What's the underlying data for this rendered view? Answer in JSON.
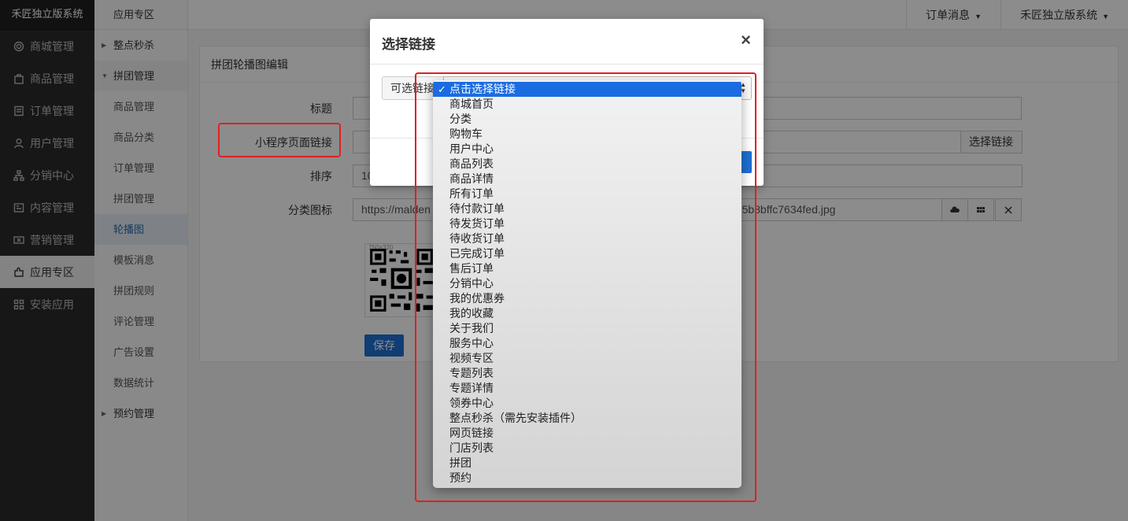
{
  "brand": "禾匠独立版系统",
  "sidebar": {
    "items": [
      {
        "label": "商城管理",
        "icon": "gear-icon"
      },
      {
        "label": "商品管理",
        "icon": "bag-icon"
      },
      {
        "label": "订单管理",
        "icon": "clipboard-icon"
      },
      {
        "label": "用户管理",
        "icon": "user-icon"
      },
      {
        "label": "分销中心",
        "icon": "network-icon"
      },
      {
        "label": "内容管理",
        "icon": "content-icon"
      },
      {
        "label": "营销管理",
        "icon": "ticket-icon"
      },
      {
        "label": "应用专区",
        "icon": "puzzle-icon"
      },
      {
        "label": "安装应用",
        "icon": "grid-icon"
      }
    ]
  },
  "submenu": {
    "head": "应用专区",
    "items": [
      "整点秒杀",
      "拼团管理",
      "商品管理",
      "商品分类",
      "订单管理",
      "拼团管理",
      "轮播图",
      "模板消息",
      "拼团规则",
      "评论管理",
      "广告设置",
      "数据统计",
      "预约管理"
    ]
  },
  "topbar": {
    "orders": "订单消息",
    "system": "禾匠独立版系统"
  },
  "panel": {
    "title": "拼团轮播图编辑",
    "labels": {
      "title": "标题",
      "link": "小程序页面链接",
      "sort": "排序",
      "icon": "分类图标"
    },
    "sort_value": "10",
    "choose_link": "选择链接",
    "icon_url_start": "https://malden",
    "icon_url_end": "d65b8bffc7634fed.jpg",
    "qr_size": "750×320",
    "save": "保存"
  },
  "modal": {
    "title": "选择链接",
    "close": "×",
    "option_label": "可选链接"
  },
  "dropdown": {
    "options": [
      "点击选择链接",
      "商城首页",
      "分类",
      "购物车",
      "用户中心",
      "商品列表",
      "商品详情",
      "所有订单",
      "待付款订单",
      "待发货订单",
      "待收货订单",
      "已完成订单",
      "售后订单",
      "分销中心",
      "我的优惠券",
      "我的收藏",
      "关于我们",
      "服务中心",
      "视频专区",
      "专题列表",
      "专题详情",
      "领券中心",
      "整点秒杀（需先安装插件）",
      "网页链接",
      "门店列表",
      "拼团",
      "预约"
    ],
    "selected_index": 0
  },
  "colors": {
    "accent": "#1e6fd1",
    "highlight": "#e02020",
    "sidebar_bg": "#2b2b2b"
  }
}
